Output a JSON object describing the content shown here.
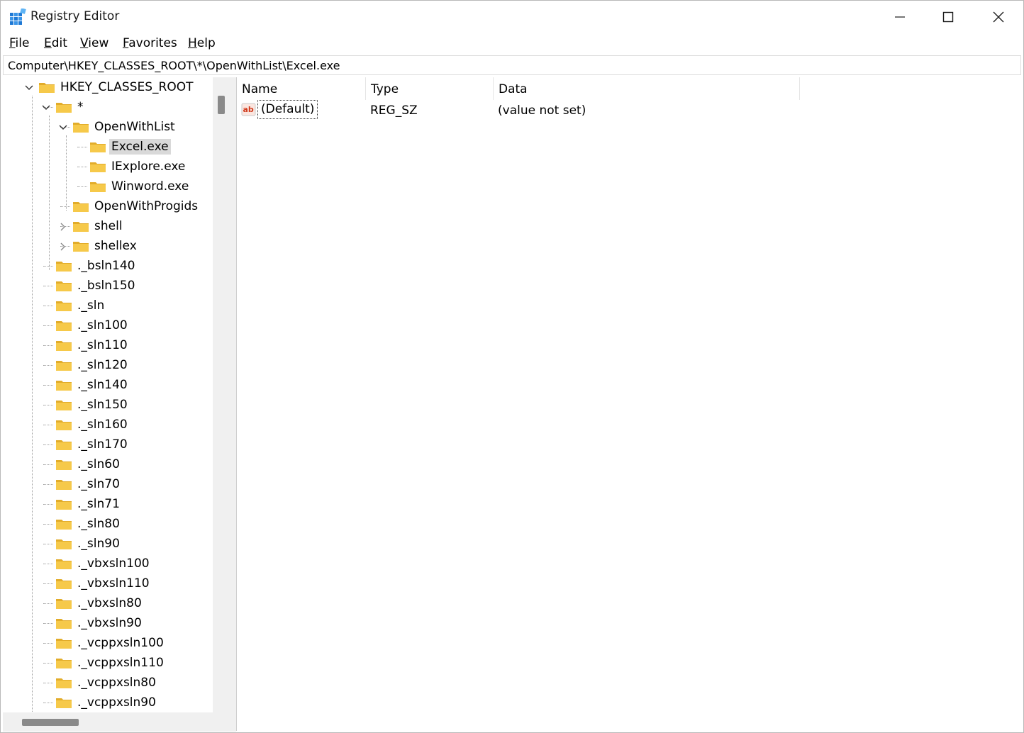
{
  "window": {
    "title": "Registry Editor",
    "minimize_glyph": "minimize-icon",
    "maximize_glyph": "maximize-icon",
    "close_glyph": "close-icon"
  },
  "menu": [
    {
      "acc": "F",
      "rest": "ile"
    },
    {
      "acc": "E",
      "rest": "dit"
    },
    {
      "acc": "V",
      "rest": "iew"
    },
    {
      "acc": "F",
      "rest": "avorites"
    },
    {
      "acc": "H",
      "rest": "elp"
    }
  ],
  "address": "Computer\\HKEY_CLASSES_ROOT\\*\\OpenWithList\\Excel.exe",
  "tree": [
    {
      "label": "HKEY_CLASSES_ROOT",
      "depth": 0,
      "expander": "open"
    },
    {
      "label": "*",
      "depth": 1,
      "expander": "open"
    },
    {
      "label": "OpenWithList",
      "depth": 2,
      "expander": "open"
    },
    {
      "label": "Excel.exe",
      "depth": 3,
      "expander": "none",
      "selected": true
    },
    {
      "label": "IExplore.exe",
      "depth": 3,
      "expander": "none"
    },
    {
      "label": "Winword.exe",
      "depth": 3,
      "expander": "none"
    },
    {
      "label": "OpenWithProgids",
      "depth": 2,
      "expander": "none"
    },
    {
      "label": "shell",
      "depth": 2,
      "expander": "closed"
    },
    {
      "label": "shellex",
      "depth": 2,
      "expander": "closed"
    },
    {
      "label": "._bsln140",
      "depth": 1,
      "expander": "none"
    },
    {
      "label": "._bsln150",
      "depth": 1,
      "expander": "none"
    },
    {
      "label": "._sln",
      "depth": 1,
      "expander": "none"
    },
    {
      "label": "._sln100",
      "depth": 1,
      "expander": "none"
    },
    {
      "label": "._sln110",
      "depth": 1,
      "expander": "none"
    },
    {
      "label": "._sln120",
      "depth": 1,
      "expander": "none"
    },
    {
      "label": "._sln140",
      "depth": 1,
      "expander": "none"
    },
    {
      "label": "._sln150",
      "depth": 1,
      "expander": "none"
    },
    {
      "label": "._sln160",
      "depth": 1,
      "expander": "none"
    },
    {
      "label": "._sln170",
      "depth": 1,
      "expander": "none"
    },
    {
      "label": "._sln60",
      "depth": 1,
      "expander": "none"
    },
    {
      "label": "._sln70",
      "depth": 1,
      "expander": "none"
    },
    {
      "label": "._sln71",
      "depth": 1,
      "expander": "none"
    },
    {
      "label": "._sln80",
      "depth": 1,
      "expander": "none"
    },
    {
      "label": "._sln90",
      "depth": 1,
      "expander": "none"
    },
    {
      "label": "._vbxsln100",
      "depth": 1,
      "expander": "none"
    },
    {
      "label": "._vbxsln110",
      "depth": 1,
      "expander": "none"
    },
    {
      "label": "._vbxsln80",
      "depth": 1,
      "expander": "none"
    },
    {
      "label": "._vbxsln90",
      "depth": 1,
      "expander": "none"
    },
    {
      "label": "._vcppxsln100",
      "depth": 1,
      "expander": "none"
    },
    {
      "label": "._vcppxsln110",
      "depth": 1,
      "expander": "none"
    },
    {
      "label": "._vcppxsln80",
      "depth": 1,
      "expander": "none"
    },
    {
      "label": "._vcppxsln90",
      "depth": 1,
      "expander": "none"
    }
  ],
  "list": {
    "columns": [
      "Name",
      "Type",
      "Data"
    ],
    "rows": [
      {
        "name": "(Default)",
        "type": "REG_SZ",
        "data": "(value not set)",
        "icon": "string-value-icon"
      }
    ]
  },
  "colors": {
    "folder": "#f6c94a",
    "folder_dark": "#e2ac2a",
    "selection": "#d9d9d9",
    "accent": "#1e78d4"
  }
}
